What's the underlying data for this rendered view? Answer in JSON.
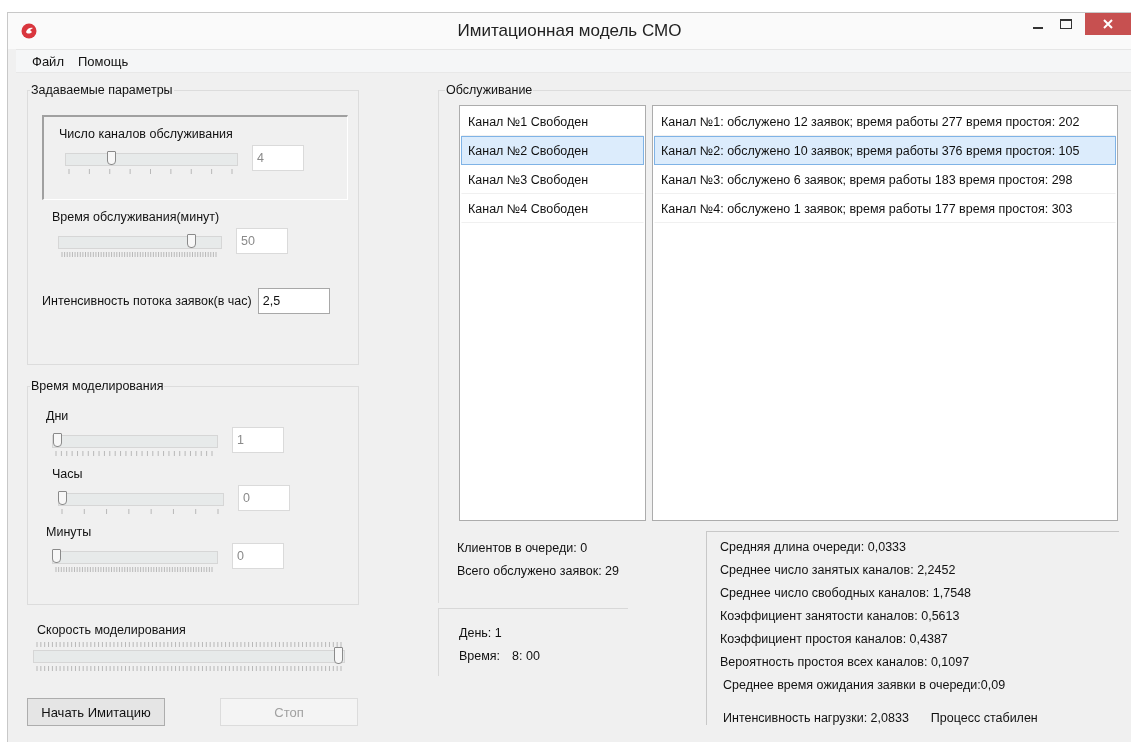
{
  "window": {
    "title": "Имитационная модель СМО"
  },
  "menu": [
    "Файл",
    "Помощь"
  ],
  "params": {
    "title": "Задаваемые параметры",
    "controls": [
      {
        "kind": "slider",
        "label": "Число каналов обслуживания",
        "level": 0.27,
        "value": "4",
        "disabled": true,
        "framed": true
      },
      {
        "kind": "slider",
        "label": "Время обслуживания(минут)",
        "level": 0.82,
        "value": "50",
        "disabled": true,
        "framed": false
      },
      {
        "kind": "input",
        "label": "Интенсивность потока заявок(в час)",
        "value": "2,5",
        "disabled": false
      }
    ]
  },
  "sim_time": {
    "title": "Время моделирования",
    "controls": [
      {
        "kind": "slider",
        "label": "Дни",
        "level": 0.03,
        "value": "1",
        "disabled": true
      },
      {
        "kind": "slider",
        "label": "Часы",
        "level": 0.0,
        "value": "0",
        "disabled": true
      },
      {
        "kind": "slider",
        "label": "Минуты",
        "level": 0.0,
        "value": "0",
        "disabled": true
      }
    ]
  },
  "speed": {
    "label": "Скорость моделирования",
    "level": 1.0
  },
  "buttons": [
    {
      "label": "Начать Имитацию",
      "disabled": false
    },
    {
      "label": "Стоп",
      "disabled": true
    }
  ],
  "service": {
    "title": "Обслуживание",
    "channels": [
      {
        "label": "Канал №1 Свободен",
        "selected": false
      },
      {
        "label": "Канал №2 Свободен",
        "selected": true
      },
      {
        "label": "Канал №3 Свободен",
        "selected": false
      },
      {
        "label": "Канал №4 Свободен",
        "selected": false
      }
    ],
    "stats": [
      {
        "label": "Канал №1: обслужено 12 заявок; время работы 277 время простоя: 202",
        "selected": false
      },
      {
        "label": "Канал №2: обслужено 10 заявок; время работы 376 время простоя: 105",
        "selected": true
      },
      {
        "label": "Канал №3: обслужено 6 заявок; время работы 183 время простоя: 298",
        "selected": false
      },
      {
        "label": "Канал №4: обслужено 1 заявок; время работы 177 время простоя: 303",
        "selected": false
      }
    ]
  },
  "queue": [
    "Клиентов в очереди: 0",
    "Всего обслужено заявок: 29"
  ],
  "clock": {
    "day": "День: 1",
    "time_label": "Время:",
    "time": "8: 00"
  },
  "metrics": [
    "Средняя длина очереди: 0,0333",
    "Среднее число занятых каналов: 2,2452",
    "Среднее число свободных каналов: 1,7548",
    "Коэффициент занятости каналов: 0,5613",
    "Коэффициент простоя каналов: 0,4387",
    "Вероятность простоя всех каналов: 0,1097",
    "Среднее время ожидания заявки в очереди:0,09"
  ],
  "load": {
    "intensity": "Интенсивность нагрузки: 2,0833",
    "status": "Процесс стабилен"
  }
}
